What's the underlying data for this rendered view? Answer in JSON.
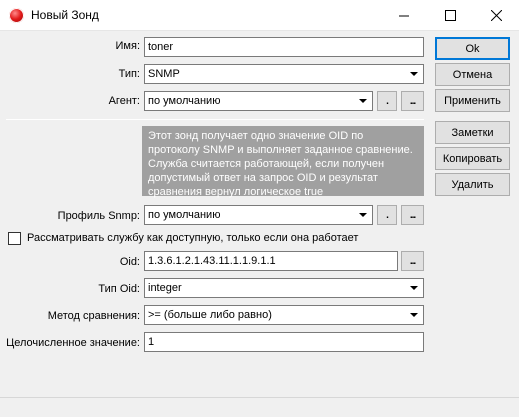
{
  "window": {
    "title": "Новый Зонд",
    "minimize_glyph": "—",
    "maximize_glyph": "☐",
    "close_glyph": "✕"
  },
  "form": {
    "name_label": "Имя:",
    "name_value": "toner",
    "type_label": "Тип:",
    "type_value": "SNMP",
    "agent_label": "Агент:",
    "agent_value": "по умолчанию",
    "info_text": "Этот зонд получает одно значение OID по протоколу SNMP и выполняет заданное сравнение. Служба считается работающей, если получен допустимый ответ на запрос OID и результат сравнения вернул логическое true",
    "snmp_profile_label": "Профиль Snmp:",
    "snmp_profile_value": "по умолчанию",
    "checkbox_label": "Рассматривать службу как доступную, только если она работает",
    "checkbox_checked": false,
    "oid_label": "Oid:",
    "oid_value": "1.3.6.1.2.1.43.11.1.1.9.1.1",
    "oid_type_label": "Тип Oid:",
    "oid_type_value": "integer",
    "compare_label": "Метод сравнения:",
    "compare_value": ">= (больше либо равно)",
    "int_value_label": "Целочисленное значение:",
    "int_value": "1"
  },
  "small_buttons": {
    "clear": ".",
    "browse": "..."
  },
  "buttons": {
    "ok": "Ok",
    "cancel": "Отмена",
    "apply": "Применить",
    "notes": "Заметки",
    "copy": "Копировать",
    "delete": "Удалить"
  }
}
